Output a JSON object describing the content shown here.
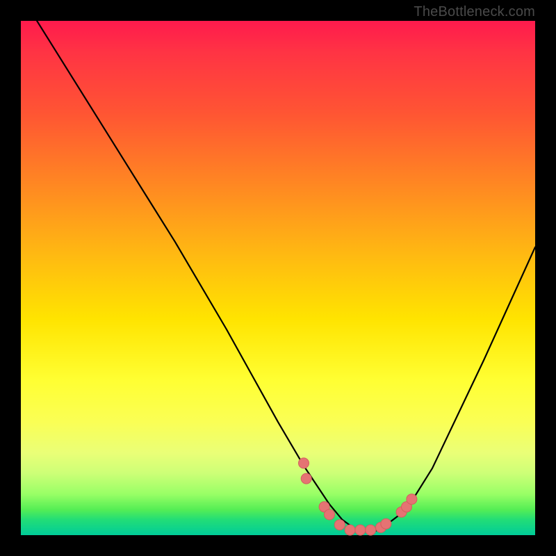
{
  "watermark": "TheBottleneck.com",
  "chart_data": {
    "type": "line",
    "title": "",
    "xlabel": "",
    "ylabel": "",
    "xlim": [
      0,
      100
    ],
    "ylim": [
      0,
      100
    ],
    "curve": {
      "x": [
        0,
        5,
        10,
        15,
        20,
        25,
        30,
        35,
        40,
        45,
        50,
        55,
        60,
        62.5,
        65,
        68,
        70,
        75,
        80,
        85,
        90,
        95,
        100
      ],
      "y": [
        105,
        97,
        89,
        81,
        73,
        65,
        57,
        48.5,
        40,
        31,
        22,
        13.5,
        6,
        3,
        1.2,
        0.5,
        1.2,
        5,
        13,
        23.5,
        34,
        45,
        56
      ]
    },
    "markers": {
      "x": [
        55,
        55.5,
        59,
        60,
        62,
        64,
        66,
        68,
        70,
        71,
        74,
        75,
        76
      ],
      "y": [
        14,
        11,
        5.5,
        4,
        2,
        1,
        1,
        1,
        1.5,
        2.2,
        4.5,
        5.5,
        7
      ]
    }
  },
  "colors": {
    "curve": "#000000",
    "marker_fill": "#e57373",
    "marker_stroke": "#d35f5f"
  }
}
